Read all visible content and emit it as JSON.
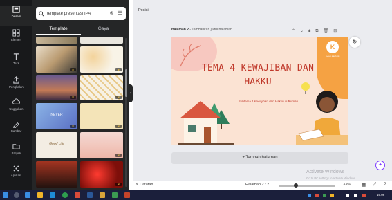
{
  "rail": {
    "items": [
      {
        "label": "Desain",
        "icon": "layout-icon"
      },
      {
        "label": "Elemen",
        "icon": "shapes-icon"
      },
      {
        "label": "Teks",
        "icon": "text-icon"
      },
      {
        "label": "Pengkalan",
        "icon": "upload-icon"
      },
      {
        "label": "Unggahan",
        "icon": "cloud-upload-icon"
      },
      {
        "label": "Gambar",
        "icon": "draw-icon"
      },
      {
        "label": "Proyek",
        "icon": "folder-icon"
      },
      {
        "label": "Aplikasi",
        "icon": "apps-grid-icon"
      }
    ]
  },
  "panel": {
    "search_value": "template presentasi IPA",
    "tabs": [
      "Template",
      "Gaya"
    ],
    "thumb_texts": [
      "NEVER",
      "Good Life"
    ]
  },
  "editor": {
    "toolbar_label": "Posisi",
    "page_title": "Halaman 2",
    "page_placeholder": " - Tambahkan judul halaman",
    "add_page": "+ Tambah halaman",
    "slide": {
      "title_line1": "TEMA 4 KEWAJIBAN DAN",
      "title_line2": "HAKKU",
      "subtitle": "Subtema 1 kewajiban dan Hakku di Rumah",
      "logo_text": "K",
      "logo_caption": "KAKANTOR"
    },
    "watermark_title": "Activate Windows",
    "watermark_sub": "Go to PC settings to activate Windows."
  },
  "bottombar": {
    "notes": "Catatan",
    "page_count": "Halaman 2 / 2",
    "zoom": "33%",
    "zoom_fraction": 0.3
  },
  "taskbar": {
    "clock": "16:06"
  }
}
